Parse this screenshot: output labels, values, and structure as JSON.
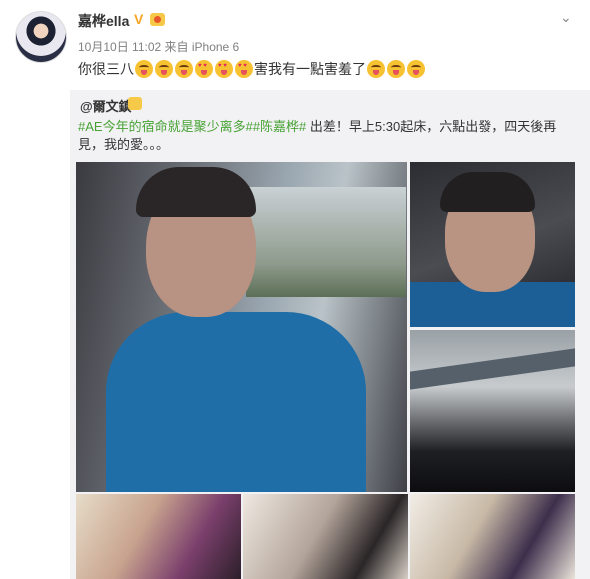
{
  "post": {
    "author": "嘉桦ella",
    "verified_badge": "V",
    "timestamp": "10月10日 11:02",
    "source": "来自 iPhone 6",
    "text_before": "你很三八",
    "text_middle": "害我有一點害羞了",
    "emoji_names": [
      "tongue-emoji",
      "tongue-emoji",
      "tongue-emoji",
      "heart-eyes-emoji",
      "heart-eyes-emoji",
      "heart-eyes-emoji",
      "tongue-emoji",
      "tongue-emoji",
      "tongue-emoji"
    ]
  },
  "repost": {
    "author": "@爾文鎮",
    "tag1": "#AE今年的宿命就是聚少离多#",
    "tag2": "#陈嘉桦#",
    "body": " 出差！早上5:30起床，六點出發，四天後再見，我的愛。。。"
  },
  "icons": {
    "chevron": "chevron-down-icon",
    "group": "group-icon"
  },
  "colors": {
    "accent_tag": "#48a334",
    "repost_bg": "#f2f2f5"
  }
}
